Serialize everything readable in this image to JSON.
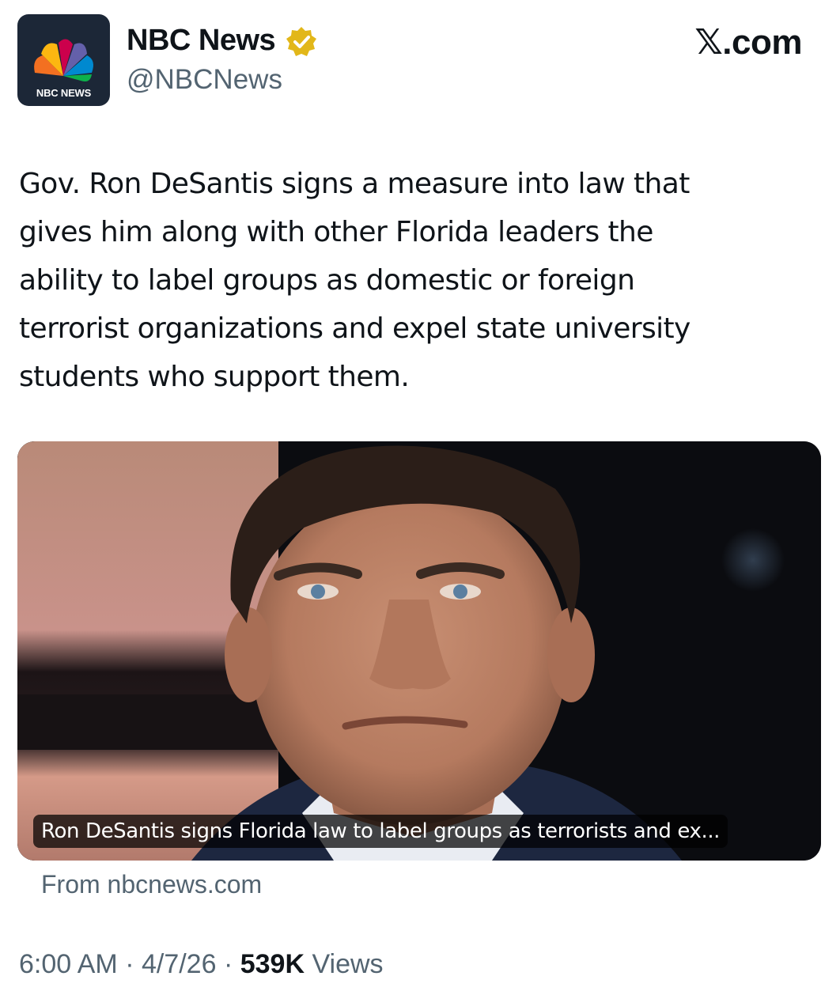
{
  "account": {
    "avatar_text": "NBC NEWS",
    "display_name": "NBC News",
    "handle": "@NBCNews",
    "verified_icon": "verified-badge-icon",
    "badge_color": "#e2b719"
  },
  "site_label": "𝕏.com",
  "tweet": {
    "lines": [
      "Gov. Ron DeSantis signs a measure into law that",
      "gives him along with other Florida leaders the",
      "ability to label groups as domestic or foreign",
      "terrorist organizations and expel state university",
      "students who support them."
    ]
  },
  "card": {
    "caption": "Ron DeSantis signs Florida law to label groups as terrorists and ex...",
    "source": "From nbcnews.com"
  },
  "meta": {
    "time": "6:00 AM",
    "sep1": " · ",
    "date": "4/7/26",
    "sep2": " · ",
    "views_count": "539K",
    "views_label": " Views"
  }
}
